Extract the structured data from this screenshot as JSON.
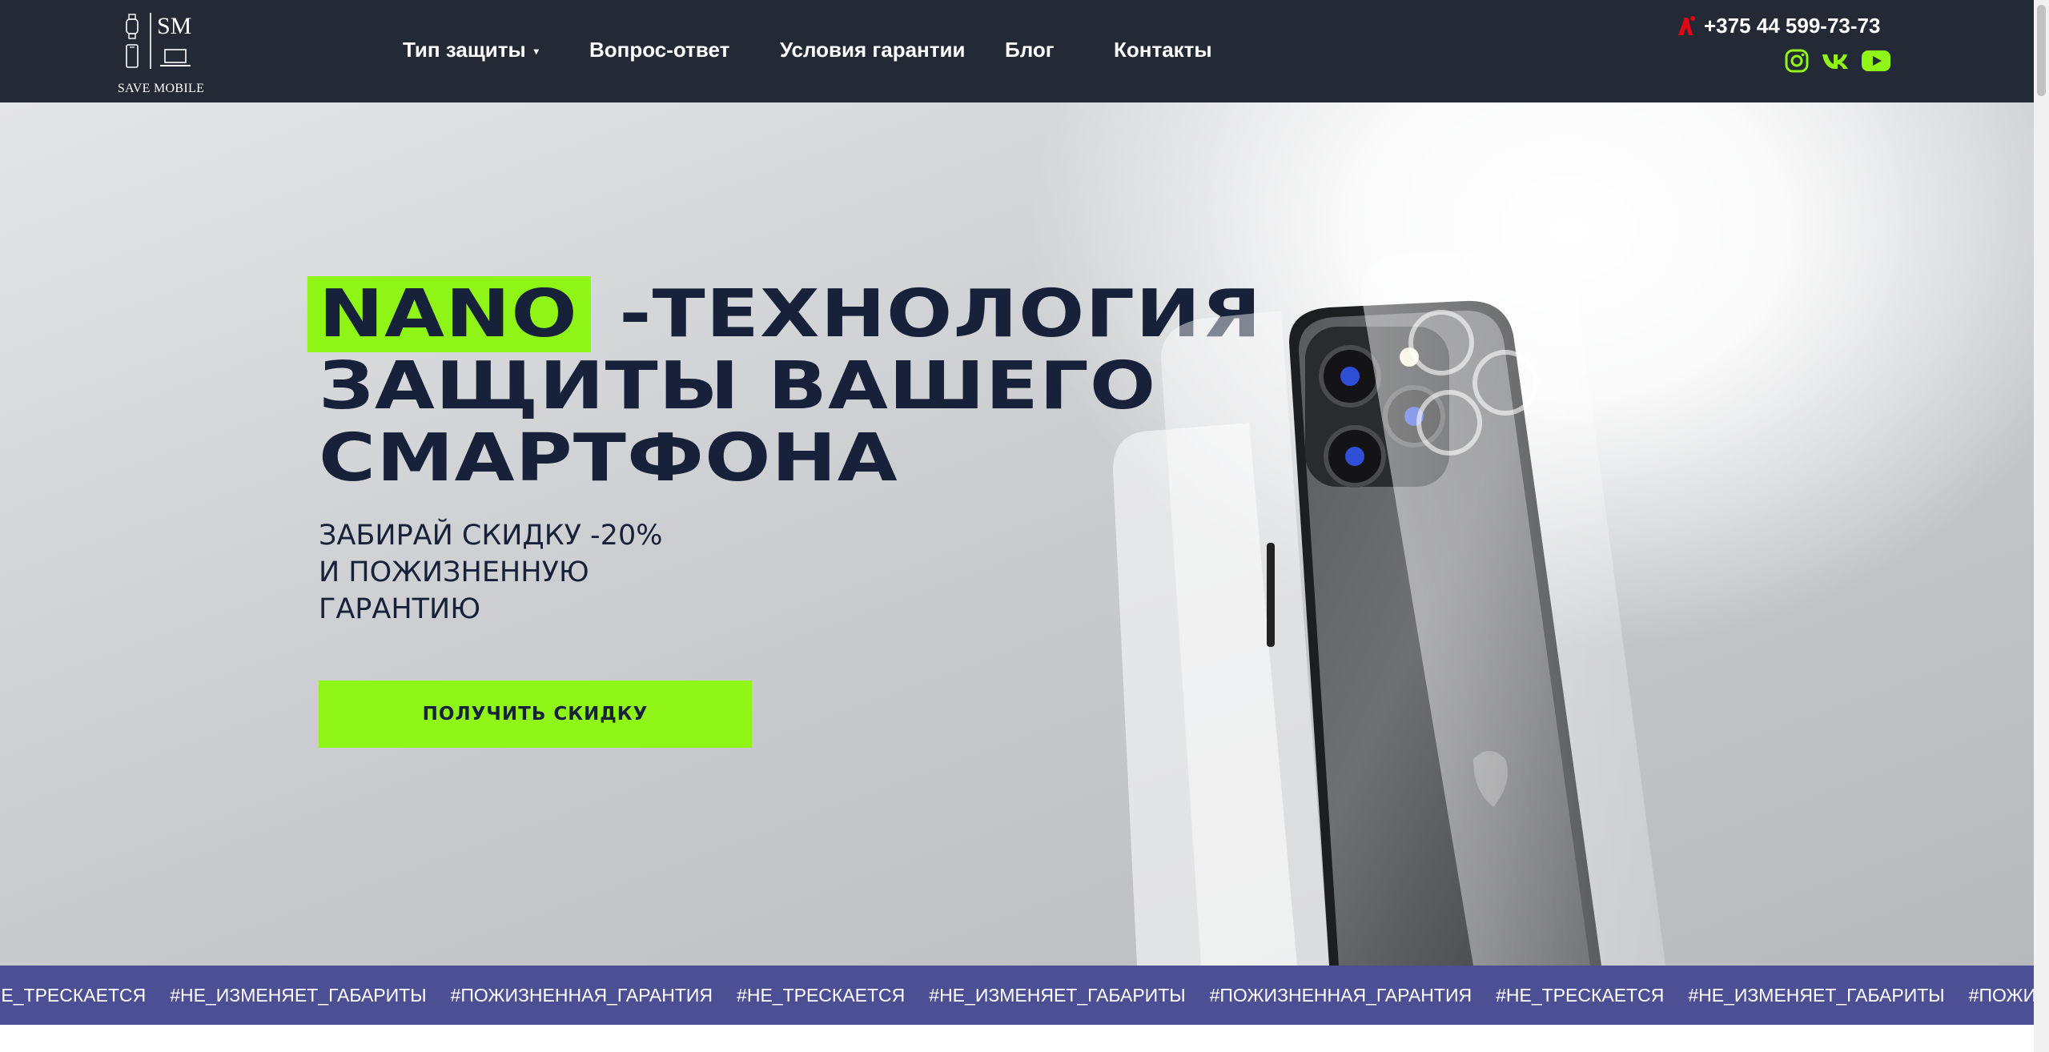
{
  "brand": {
    "monogram": "SM",
    "name": "SAVE MOBILE"
  },
  "nav": {
    "items": [
      {
        "label": "Тип защиты",
        "has_dropdown": true
      },
      {
        "label": "Вопрос-ответ"
      },
      {
        "label": "Условия гарантии"
      },
      {
        "label": "Блог"
      },
      {
        "label": "Контакты"
      }
    ]
  },
  "contacts": {
    "phone": "+375 44 599-73-73",
    "operator_icon": "a1-operator-icon",
    "social_icons": [
      "instagram-icon",
      "vk-icon",
      "youtube-icon"
    ]
  },
  "hero": {
    "headline_highlight": "NANO",
    "headline_line1_rest": "-ТЕХНОЛОГИЯ",
    "headline_line2": "ЗАЩИТЫ ВАШЕГО",
    "headline_line3": "СМАРТФОНА",
    "subtitle_lines": [
      "ЗАБИРАЙ СКИДКУ -20%",
      "И ПОЖИЗНЕННУЮ",
      "ГАРАНТИЮ"
    ],
    "cta_label": "ПОЛУЧИТЬ СКИДКУ"
  },
  "ticker": {
    "items": [
      "#НЕ_ТРЕСКАЕТСЯ",
      "#НЕ_ИЗМЕНЯЕТ_ГАБАРИТЫ",
      "#ПОЖИЗНЕННАЯ_ГАРАНТИЯ",
      "#НЕ_ТРЕСКАЕТСЯ",
      "#НЕ_ИЗМЕНЯЕТ_ГАБАРИТЫ",
      "#ПОЖИЗНЕННАЯ_ГАРАНТИЯ",
      "#НЕ_ТРЕСКАЕТСЯ",
      "#НЕ_ИЗМЕНЯЕТ_ГАБАРИТЫ",
      "#ПОЖИЗНЕННАЯ_ГАРАНТИЯ"
    ]
  },
  "colors": {
    "header_bg": "#232a35",
    "accent_green": "#8ff516",
    "heading_navy": "#17223a",
    "ticker_bg": "#4d4f94",
    "social_icon_color": "#8ff516",
    "operator_red": "#e30613"
  }
}
